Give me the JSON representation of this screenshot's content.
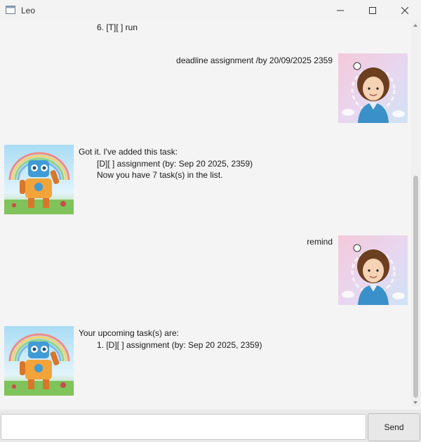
{
  "window": {
    "title": "Leo"
  },
  "messages": {
    "top_partial": "6. [T][ ] run",
    "user_1": "deadline assignment /by 20/09/2025 2359",
    "bot_1": {
      "line1": "Got it. I've added this task:",
      "line2": "[D][ ] assignment (by: Sep 20 2025, 2359)",
      "line3": "Now you have 7 task(s) in the list."
    },
    "user_2": "remind",
    "bot_2": {
      "line1": "Your upcoming task(s) are:",
      "line2": "1. [D][ ] assignment (by: Sep 20 2025, 2359)"
    }
  },
  "input": {
    "value": "",
    "placeholder": ""
  },
  "send_label": "Send",
  "icons": {
    "app": "app-window-icon",
    "minimize": "minimize-icon",
    "maximize": "maximize-icon",
    "close": "close-icon",
    "user_avatar": "user-avatar",
    "bot_avatar": "robot-avatar"
  },
  "colors": {
    "background": "#f4f4f4",
    "scroll_thumb": "#c2c2c2",
    "avatar_bot_sky": "#bfe6f7",
    "avatar_user_bg": "#e9cfe6"
  }
}
